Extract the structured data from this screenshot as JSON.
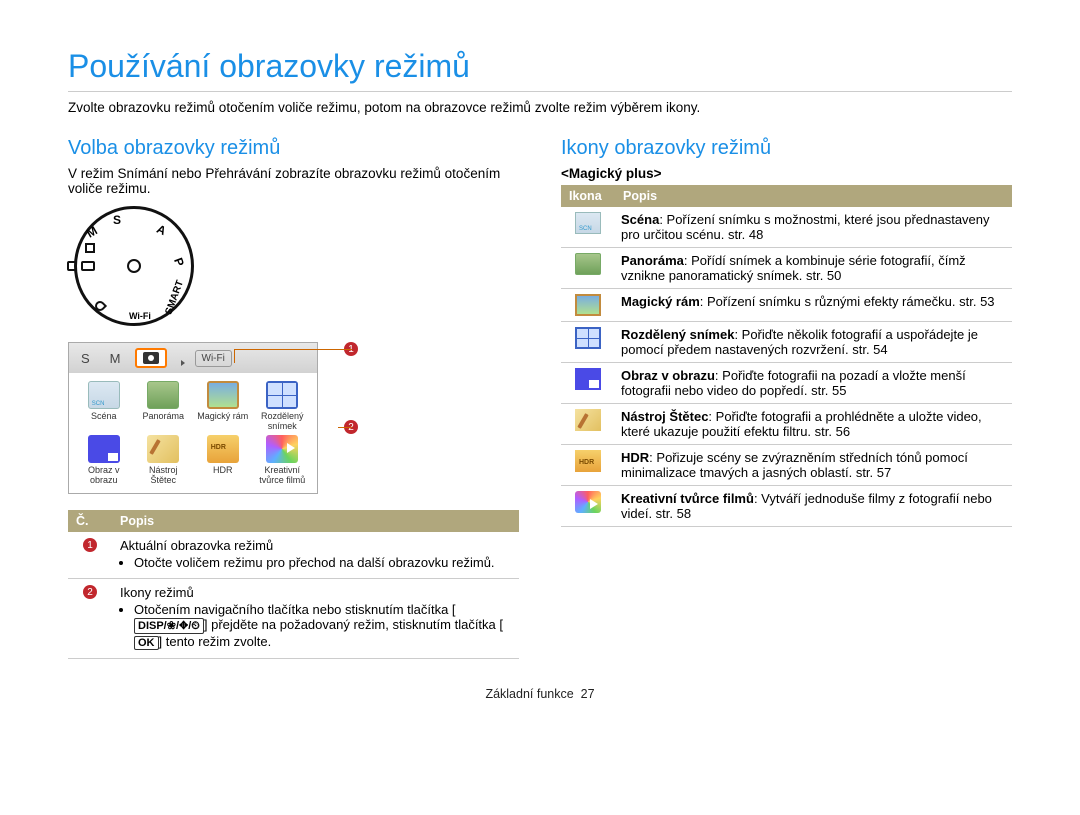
{
  "title": "Používání obrazovky režimů",
  "intro": "Zvolte obrazovku režimů otočením voliče režimu, potom na obrazovce režimů zvolte režim výběrem ikony.",
  "left": {
    "subtitle": "Volba obrazovky režimů",
    "subtext": "V režim Snímání nebo Přehrávání zobrazíte obrazovku režimů otočením voliče režimu.",
    "dial": {
      "s": "S",
      "a": "A",
      "p": "P",
      "m": "M",
      "smart": "SMART",
      "wifi": "Wi-Fi"
    },
    "tabbar": {
      "s": "S",
      "m": "M",
      "wifi": "Wi-Fi"
    },
    "gridItems": [
      {
        "label": "Scéna"
      },
      {
        "label": "Panoráma"
      },
      {
        "label": "Magický rám"
      },
      {
        "label": "Rozdělený snímek"
      },
      {
        "label": "Obraz v obrazu"
      },
      {
        "label": "Nástroj Štětec"
      },
      {
        "label": "HDR"
      },
      {
        "label": "Kreativní tvůrce filmů"
      }
    ],
    "callouts": {
      "one": "1",
      "two": "2"
    },
    "table": {
      "headers": {
        "num": "Č.",
        "desc": "Popis"
      },
      "rows": [
        {
          "num": "1",
          "title": "Aktuální obrazovka režimů",
          "bullet": "Otočte voličem režimu pro přechod na další obrazovku režimů."
        },
        {
          "num": "2",
          "title": "Ikony režimů",
          "bullet_pre": "Otočením navigačního tlačítka nebo stisknutím tlačítka [",
          "keys": "DISP/❀/✥/⏲",
          "bullet_mid": "] přejděte na požadovaný režim, stisknutím tlačítka [",
          "ok": "OK",
          "bullet_post": "] tento režim zvolte."
        }
      ]
    }
  },
  "right": {
    "subtitle": "Ikony obrazovky režimů",
    "caption": "<Magický plus>",
    "headers": {
      "icon": "Ikona",
      "desc": "Popis"
    },
    "rows": [
      {
        "name": "Scéna",
        "text": ": Pořízení snímku s možnostmi, které jsou přednastaveny pro určitou scénu. str. 48"
      },
      {
        "name": "Panoráma",
        "text": ": Pořídí snímek a kombinuje série fotografií, čímž vznikne panoramatický snímek. str. 50"
      },
      {
        "name": "Magický rám",
        "text": ": Pořízení snímku s různými efekty rámečku. str. 53"
      },
      {
        "name": "Rozdělený snímek",
        "text": ": Pořiďte několik fotografií a uspořádejte je pomocí předem nastavených rozvržení. str. 54"
      },
      {
        "name": "Obraz v obrazu",
        "text": ": Pořiďte fotografii na pozadí a vložte menší fotografii nebo video do popředí. str. 55"
      },
      {
        "name": "Nástroj Štětec",
        "text": ": Pořiďte fotografii a prohlédněte a uložte video, které ukazuje použití efektu filtru. str. 56"
      },
      {
        "name": "HDR",
        "text": ": Pořizuje scény se zvýrazněním středních tónů pomocí minimalizace tmavých a jasných oblastí. str. 57"
      },
      {
        "name": "Kreativní tvůrce filmů",
        "text": ": Vytváří jednoduše filmy z fotografií nebo videí. str. 58"
      }
    ]
  },
  "footer": {
    "section": "Základní funkce",
    "page": "27"
  }
}
